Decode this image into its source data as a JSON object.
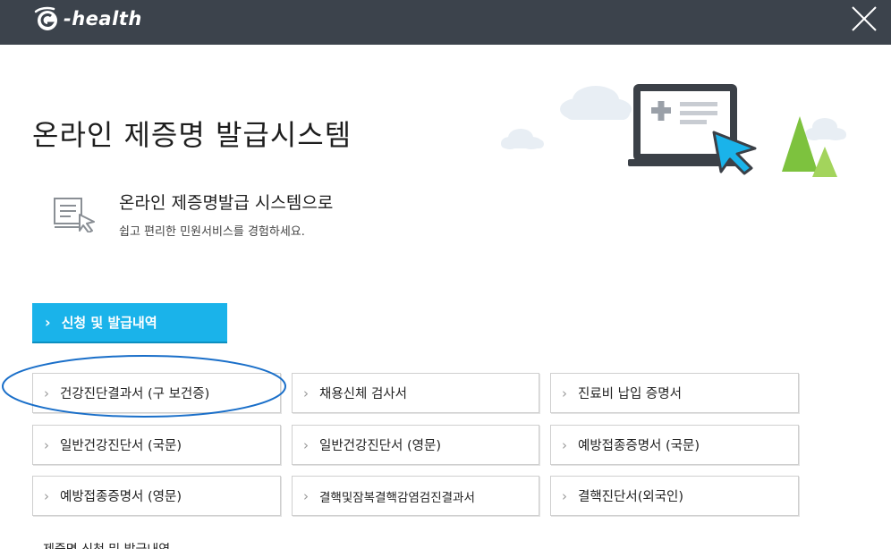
{
  "header": {
    "logo_text": "-health",
    "close_icon": "close-icon"
  },
  "page": {
    "title": "온라인 제증명 발급시스템"
  },
  "intro": {
    "headline": "온라인 제증명발급 시스템으로",
    "subline": "쉽고 편리한 민원서비스를 경험하세요."
  },
  "history_button": {
    "label": "신청 및 발급내역",
    "icon": "chevron-right-icon"
  },
  "certificates": [
    {
      "label": "건강진단결과서 (구 보건증)"
    },
    {
      "label": "채용신체 검사서"
    },
    {
      "label": "진료비 납입 증명서"
    },
    {
      "label": "일반건강진단서 (국문)"
    },
    {
      "label": "일반건강진단서 (영문)"
    },
    {
      "label": "예방접종증명서 (국문)"
    },
    {
      "label": "예방접종증명서 (영문)"
    },
    {
      "label": "결핵및잠복결핵감염검진결과서"
    },
    {
      "label": "결핵진단서(외국인)"
    }
  ],
  "bottom_partial_text": "제증명 신청 및 발급내역",
  "colors": {
    "topbar": "#3c434c",
    "accent": "#1ab3ea",
    "highlight": "#1a6fc9"
  }
}
